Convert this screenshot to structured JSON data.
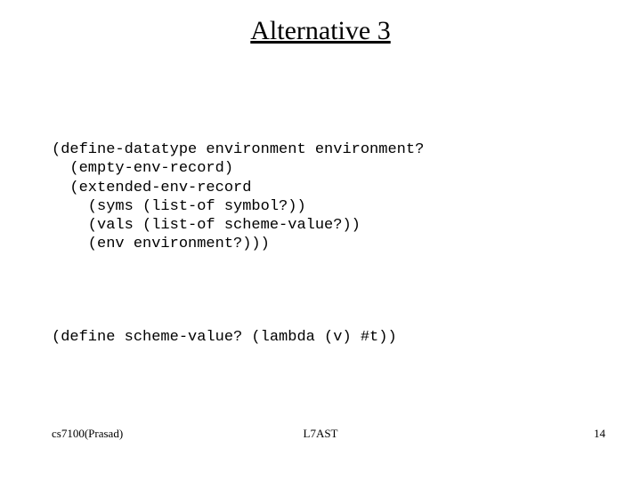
{
  "title": "Alternative 3",
  "code1": "(define-datatype environment environment?\n  (empty-env-record)\n  (extended-env-record\n    (syms (list-of symbol?))\n    (vals (list-of scheme-value?))\n    (env environment?)))",
  "code2": "(define scheme-value? (lambda (v) #t))",
  "footer": {
    "left": "cs7100(Prasad)",
    "center": "L7AST",
    "right": "14"
  }
}
